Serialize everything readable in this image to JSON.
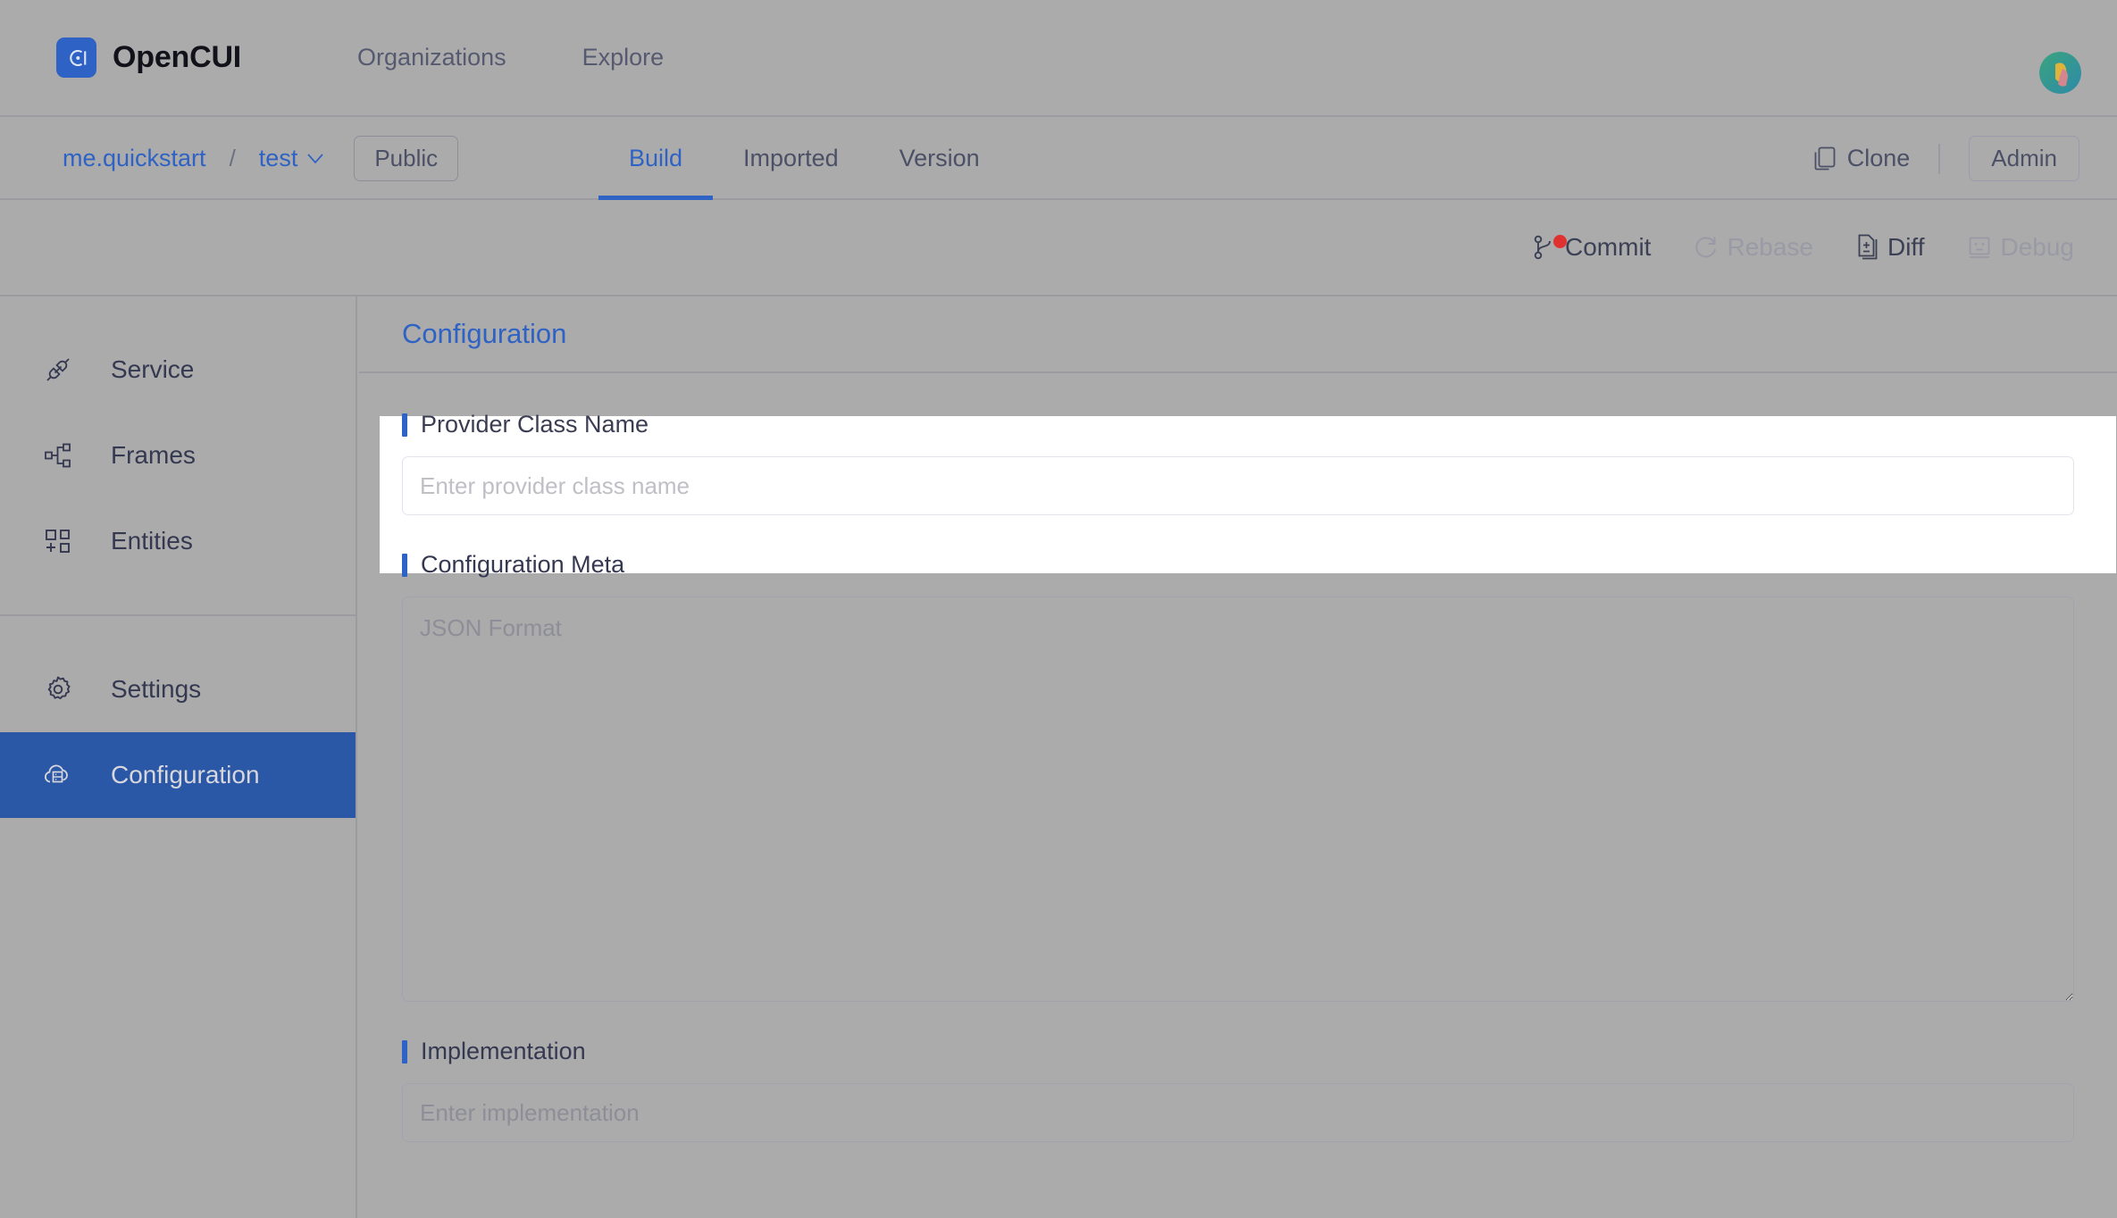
{
  "header": {
    "brand_name": "OpenCUI",
    "logo_icon": "opencui-logo-icon",
    "nav": [
      {
        "label": "Organizations",
        "name": "nav-organizations"
      },
      {
        "label": "Explore",
        "name": "nav-explore"
      }
    ],
    "avatar_icon": "user-avatar"
  },
  "repobar": {
    "org": "me.quickstart",
    "separator": "/",
    "repo": "test",
    "caret_icon": "chevron-down-icon",
    "visibility": "Public",
    "tabs": [
      {
        "label": "Build",
        "active": true
      },
      {
        "label": "Imported",
        "active": false
      },
      {
        "label": "Version",
        "active": false
      }
    ],
    "clone_label": "Clone",
    "clone_icon": "clone-icon",
    "admin_label": "Admin"
  },
  "actionbar": {
    "actions": [
      {
        "label": "Commit",
        "icon": "git-branch-icon",
        "disabled": false,
        "badge": true
      },
      {
        "label": "Rebase",
        "icon": "refresh-icon",
        "disabled": true,
        "badge": false
      },
      {
        "label": "Diff",
        "icon": "file-diff-icon",
        "disabled": false,
        "badge": false
      },
      {
        "label": "Debug",
        "icon": "debug-face-icon",
        "disabled": true,
        "badge": false
      }
    ]
  },
  "sidebar": {
    "items": [
      {
        "label": "Service",
        "icon": "plug-connection-icon",
        "active": false
      },
      {
        "label": "Frames",
        "icon": "sitemap-icon",
        "active": false
      },
      {
        "label": "Entities",
        "icon": "grid-plus-icon",
        "active": false
      },
      {
        "label": "Settings",
        "icon": "gear-icon",
        "active": false
      },
      {
        "label": "Configuration",
        "icon": "cloud-server-icon",
        "active": true
      }
    ]
  },
  "main": {
    "title": "Configuration",
    "fields": {
      "provider_class_name": {
        "label": "Provider Class Name",
        "placeholder": "Enter provider class name",
        "value": ""
      },
      "configuration_meta": {
        "label": "Configuration Meta",
        "placeholder": "JSON Format",
        "value": ""
      },
      "implementation": {
        "label": "Implementation",
        "placeholder": "Enter implementation",
        "value": ""
      }
    }
  },
  "colors": {
    "accent_blue": "#2e62c4",
    "sidebar_active": "#2b58a6",
    "page_background": "#ababab",
    "badge_red": "#e03131",
    "highlight_white": "#ffffff"
  }
}
